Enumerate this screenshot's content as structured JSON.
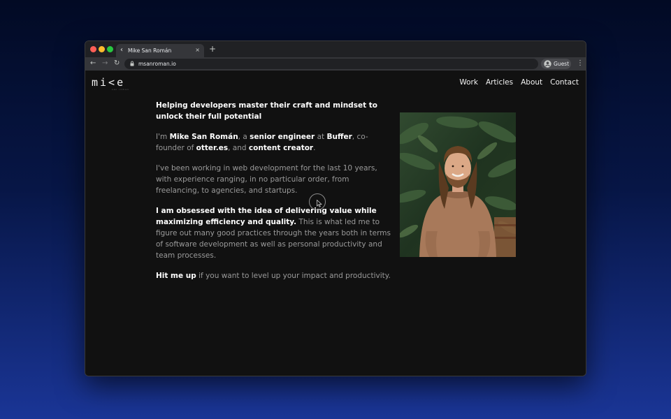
{
  "browser": {
    "tab_title": "Mike San Román",
    "new_tab_symbol": "+",
    "tab_close_symbol": "×",
    "url": "msanroman.io",
    "profile_label": "Guest",
    "icons": {
      "favicon": "mike-k-logo-icon",
      "back": "arrow-left-icon",
      "forward": "arrow-right-icon",
      "reload": "reload-icon",
      "lock": "lock-icon",
      "profile": "person-circle-icon",
      "menu": "vertical-dots-icon"
    },
    "colors": {
      "close": "#ff5f57",
      "minimize": "#febc2e",
      "maximize": "#28c840"
    }
  },
  "site": {
    "logo": "mi<e",
    "logo_subtext": "san roman",
    "nav": [
      {
        "label": "Work"
      },
      {
        "label": "Articles"
      },
      {
        "label": "About"
      },
      {
        "label": "Contact"
      }
    ],
    "headline": "Helping developers master their craft and mindset to unlock their full potential",
    "intro": {
      "t1": "I'm ",
      "name": "Mike San Román",
      "t2": ", a ",
      "role": "senior engineer",
      "t3": " at ",
      "company": "Buffer",
      "t4": ", co-founder of ",
      "project": "otter.es",
      "t5": ", and ",
      "role2": "content creator",
      "t6": "."
    },
    "experience": "I've been working in web development for the last 10 years, with experience ranging, in no particular order, from freelancing, to agencies, and startups.",
    "obsessed": {
      "bold": "I am obsessed with the idea of delivering value while maximizing efficiency and quality.",
      "rest": " This is what led me to figure out many good practices through the years both in terms of software development as well as personal productivity and team processes."
    },
    "cta": {
      "bold": "Hit me up",
      "rest": " if you want to level up your impact and productivity."
    },
    "photo_icon": "portrait-photo-icon",
    "colors": {
      "background": "#111111",
      "heading": "#ffffff",
      "body_text": "#9a9a9a"
    }
  }
}
